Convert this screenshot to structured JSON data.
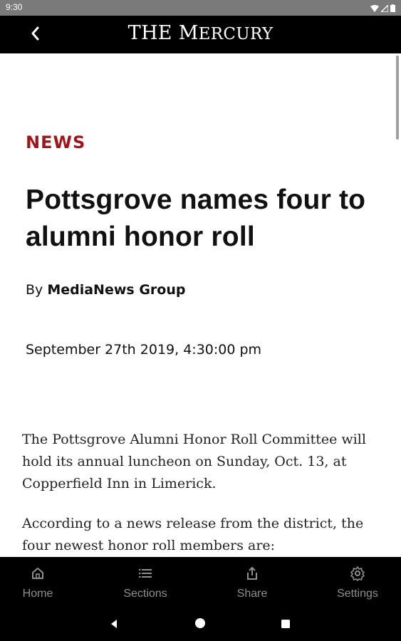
{
  "status_bar": {
    "time": "9:30",
    "icons": [
      "wifi-icon",
      "signal-icon",
      "battery-icon"
    ]
  },
  "header": {
    "masthead_the": "THE ",
    "masthead_m": "M",
    "masthead_rest": "ERCURY",
    "back_icon": "chevron-left-icon"
  },
  "article": {
    "category": "NEWS",
    "headline": "Pottsgrove names four to alumni honor roll",
    "byline_prefix": "By ",
    "author": "MediaNews Group",
    "date": "September 27th 2019, 4:30:00 pm",
    "paragraphs": [
      "The Pottsgrove Alumni Honor Roll Committee will hold its annual luncheon on Sunday, Oct. 13, at Copperfield Inn in Limerick.",
      "According to a news release from the district, the four newest honor roll members are:"
    ]
  },
  "bottom_nav": {
    "items": [
      {
        "label": "Home",
        "icon": "home-icon"
      },
      {
        "label": "Sections",
        "icon": "list-icon"
      },
      {
        "label": "Share",
        "icon": "share-icon"
      },
      {
        "label": "Settings",
        "icon": "gear-icon"
      }
    ]
  },
  "system_nav": {
    "buttons": [
      "back-triangle-icon",
      "home-circle-icon",
      "recents-square-icon"
    ]
  },
  "colors": {
    "category_red": "#a2151b",
    "header_bg": "#000000",
    "nav_gray": "#8f8f8f",
    "status_bar_bg": "#7a7a7a"
  }
}
